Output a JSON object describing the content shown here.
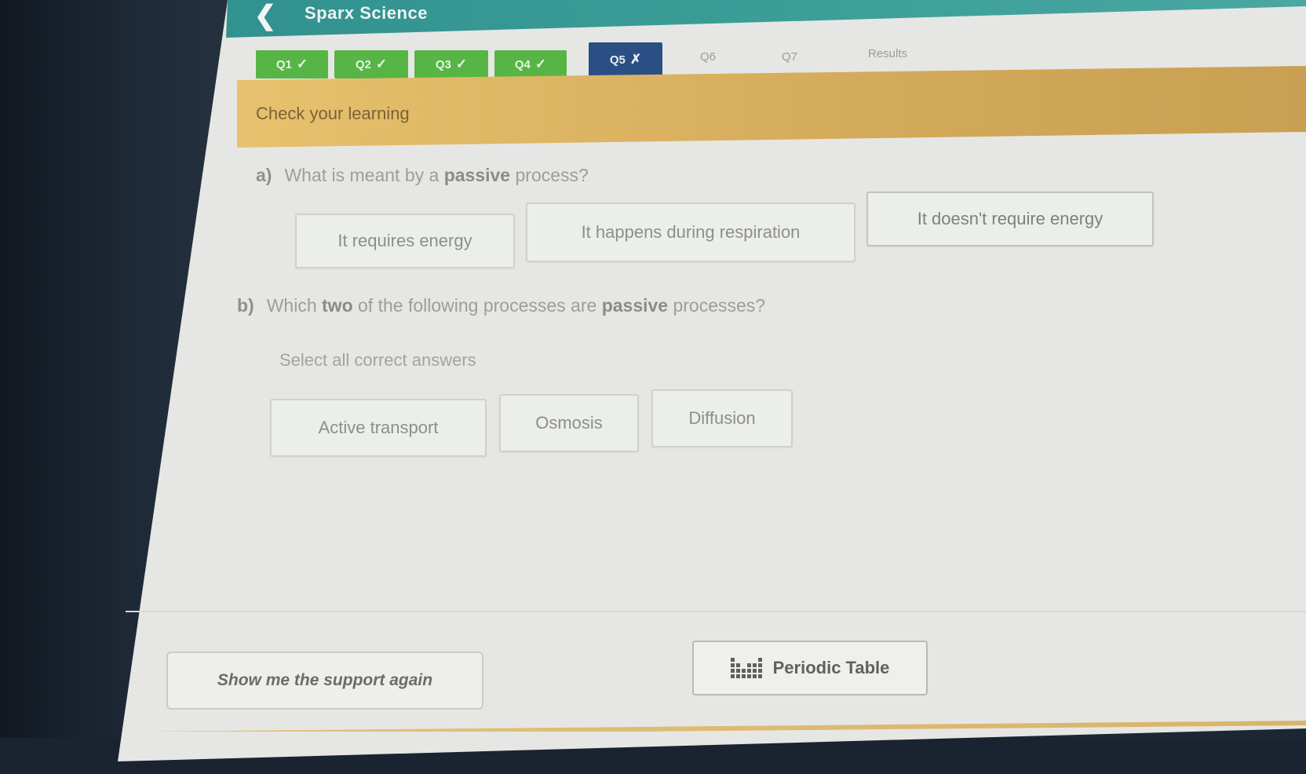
{
  "header": {
    "back_icon": "chevron-left-icon",
    "title": "Sparx Science"
  },
  "tabs": [
    {
      "label": "Q1",
      "status": "correct"
    },
    {
      "label": "Q2",
      "status": "correct"
    },
    {
      "label": "Q3",
      "status": "correct"
    },
    {
      "label": "Q4",
      "status": "correct"
    },
    {
      "label": "Q5",
      "status": "incorrect"
    },
    {
      "label": "Q6",
      "status": "pending"
    },
    {
      "label": "Q7",
      "status": "pending"
    },
    {
      "label": "Results",
      "status": "pending"
    }
  ],
  "marks": {
    "correct": "✓",
    "incorrect": "✗"
  },
  "banner": {
    "text": "Check your learning"
  },
  "question_a": {
    "label": "a)",
    "text_prefix": "What is meant by a ",
    "text_bold": "passive",
    "text_suffix": " process?",
    "answers": [
      "It requires energy",
      "It happens during respiration",
      "It doesn't require energy"
    ]
  },
  "question_b": {
    "label": "b)",
    "text_prefix": "Which ",
    "text_bold1": "two",
    "text_middle": " of the following processes are ",
    "text_bold2": "passive",
    "text_suffix": " processes?",
    "hint": "Select all correct answers",
    "answers": [
      "Active transport",
      "Osmosis",
      "Diffusion"
    ]
  },
  "footer": {
    "support_button": "Show me the support again",
    "periodic_button": "Periodic Table",
    "periodic_icon": "periodic-table-icon"
  },
  "colors": {
    "topbar": "#3a9c97",
    "correct_tab": "#57b545",
    "incorrect_tab": "#2a4f85",
    "banner": "#d3aa5a"
  }
}
